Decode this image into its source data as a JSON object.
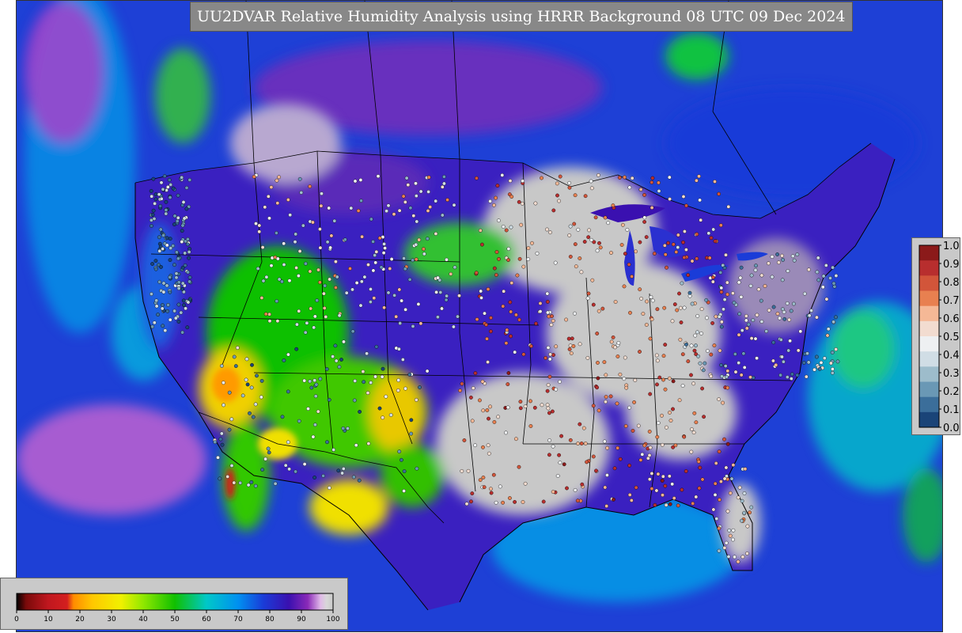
{
  "header": {
    "title": "UU2DVAR Relative Humidity Analysis using HRRR Background 08 UTC 09 Dec 2024"
  },
  "map_view": {
    "projection": "Lambert conformal",
    "region": "CONUS",
    "field": "2-m relative humidity",
    "overlay": "station observations (colored dots)",
    "boundaries": [
      "country",
      "state",
      "coastline",
      "lakes"
    ]
  },
  "rh_colorbar": {
    "units": "percent",
    "min": 0,
    "max": 100,
    "ticks": [
      "0",
      "10",
      "20",
      "30",
      "40",
      "50",
      "60",
      "70",
      "80",
      "90",
      "100"
    ],
    "stops": [
      {
        "value": 0,
        "color": "#000000"
      },
      {
        "value": 3,
        "color": "#7a0a0a"
      },
      {
        "value": 10,
        "color": "#c0171f"
      },
      {
        "value": 16,
        "color": "#d41f1f"
      },
      {
        "value": 18,
        "color": "#ff8c00"
      },
      {
        "value": 24,
        "color": "#ffc800"
      },
      {
        "value": 33,
        "color": "#f0f000"
      },
      {
        "value": 40,
        "color": "#90e800"
      },
      {
        "value": 50,
        "color": "#10c000"
      },
      {
        "value": 60,
        "color": "#00c8c8"
      },
      {
        "value": 70,
        "color": "#0090f0"
      },
      {
        "value": 78,
        "color": "#1a3cd8"
      },
      {
        "value": 86,
        "color": "#3a10b0"
      },
      {
        "value": 92,
        "color": "#8a2ab8"
      },
      {
        "value": 96,
        "color": "#e0b8e8"
      },
      {
        "value": 98,
        "color": "#d8d8d8"
      },
      {
        "value": 100,
        "color": "#c8c8c8"
      }
    ]
  },
  "obs_colorbar": {
    "ticks": [
      "1.0",
      "0.9",
      "0.8",
      "0.7",
      "0.6",
      "0.5",
      "0.4",
      "0.3",
      "0.2",
      "0.1",
      "0.0"
    ],
    "colors": [
      "#8b1a1a",
      "#b82e2e",
      "#d2553a",
      "#e88050",
      "#f5b896",
      "#f2dcd0",
      "#eef0f2",
      "#d0dde5",
      "#9dbccb",
      "#6a98b5",
      "#3b6e9a",
      "#1a4478"
    ]
  },
  "colors": {
    "ocean": "#1a3cd8",
    "land_dry": "#10c000",
    "land_saturated": "#c8c8c8",
    "boundary": "#000000",
    "panel": "#c9c9c9",
    "title_bg": "#888888"
  }
}
